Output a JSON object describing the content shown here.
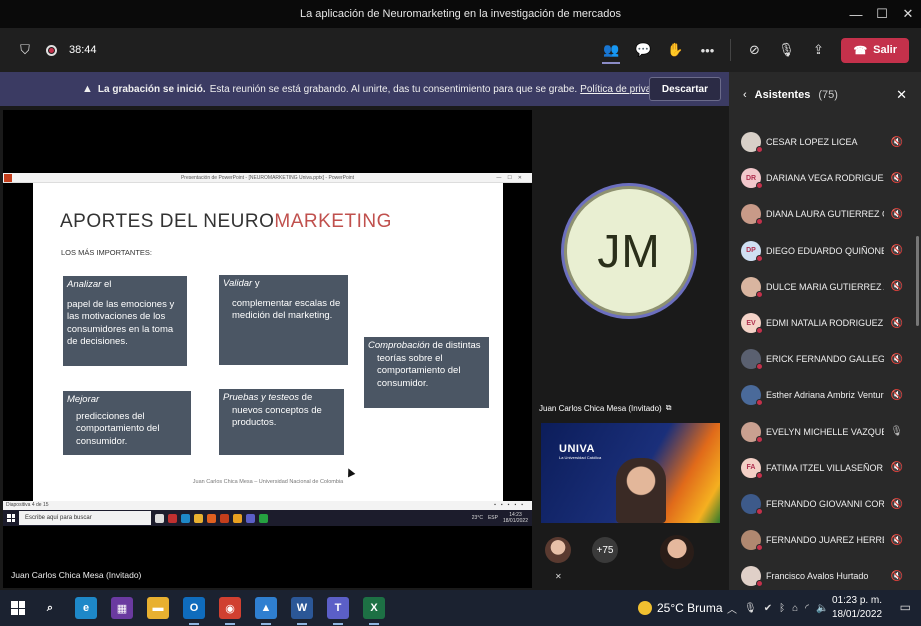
{
  "window": {
    "title": "La aplicación de Neuromarketing en la investigación de mercados"
  },
  "meeting": {
    "timer": "38:44",
    "leave_label": "Salir",
    "icons": [
      "shield-icon",
      "record-icon",
      "people-icon",
      "chat-icon",
      "reactions-icon",
      "more-icon",
      "camera-off-icon",
      "mic-off-icon",
      "share-icon"
    ]
  },
  "banner": {
    "bold": "La grabación se inició.",
    "text": "Esta reunión se está grabando. Al unirte, das tu consentimiento para que se grabe.",
    "link": "Política de privacidad",
    "dismiss": "Descartar"
  },
  "share": {
    "presenter_label": "Juan Carlos Chica Mesa (Invitado)",
    "ppt_title": "Presentación de PowerPoint - [NEUROMARKETING Univa.pptx] - PowerPoint",
    "slide_status": "Diapositiva 4 de 15",
    "slide": {
      "title_a": "APORTES DEL NEURO",
      "title_b": "MARKETING",
      "subtitle": "LOS MÁS IMPORTANTES:",
      "boxes": [
        {
          "head": "Analizar",
          "head_rest": " el",
          "body": "papel de las emociones y las motivaciones de los consumidores en la toma de decisiones."
        },
        {
          "head": "Validar",
          "head_rest": " y",
          "body": "complementar escalas de medición del marketing."
        },
        {
          "head": "Comprobación",
          "head_rest": " de distintas",
          "body": "teorías sobre el comportamiento del consumidor."
        },
        {
          "head": "Mejorar",
          "head_rest": "",
          "body": "predicciones del comportamiento del consumidor."
        },
        {
          "head": "Pruebas y testeos",
          "head_rest": " de",
          "body": "nuevos conceptos de productos."
        }
      ],
      "footer": "Juan Carlos Chica Mesa – Universidad Nacional de Colombia"
    },
    "inner_taskbar": {
      "search": "Escribe aquí para buscar",
      "weather": "23°C",
      "lang": "ESP",
      "time": "14:23",
      "date": "18/01/2022"
    }
  },
  "stage": {
    "avatar_initials": "JM",
    "camera_label": "Juan Carlos Chica Mesa (Invitado)",
    "camera_logo": "UNIVA",
    "camera_logo_sub": "La Universidad Católica",
    "overflow_count": "+75"
  },
  "attendees": {
    "title": "Asistentes",
    "count": "(75)",
    "list": [
      {
        "name": "CESAR LOPEZ LICEA",
        "initials": "",
        "color": "#d8d0c8",
        "mic": "mic-off-icon"
      },
      {
        "name": "DARIANA VEGA RODRIGUEZ",
        "initials": "DR",
        "color": "#f1c7cb",
        "mic": "mic-off-icon"
      },
      {
        "name": "DIANA LAURA GUTIERREZ G...",
        "initials": "",
        "color": "#c89a88",
        "mic": "mic-off-icon"
      },
      {
        "name": "DIEGO EDUARDO QUIÑONEZ...",
        "initials": "DP",
        "color": "#cfe0f3",
        "mic": "mic-off-icon"
      },
      {
        "name": "DULCE MARIA GUTIERREZ AN...",
        "initials": "",
        "color": "#d9b5a0",
        "mic": "mic-off-icon"
      },
      {
        "name": "EDMI NATALIA RODRIGUEZ V...",
        "initials": "EV",
        "color": "#f4d3c8",
        "mic": "mic-off-icon"
      },
      {
        "name": "ERICK FERNANDO GALLEGOS...",
        "initials": "",
        "color": "#5a6070",
        "mic": "mic-off-icon"
      },
      {
        "name": "Esther Adriana Ambriz Ventura",
        "initials": "",
        "color": "#4a6a9a",
        "mic": "mic-off-icon"
      },
      {
        "name": "EVELYN MICHELLE VAZQUEZ ...",
        "initials": "",
        "color": "#c9a090",
        "mic": "mic-icon"
      },
      {
        "name": "FATIMA ITZEL VILLASEÑOR AL...",
        "initials": "FA",
        "color": "#f3d0c6",
        "mic": "mic-off-icon"
      },
      {
        "name": "FERNANDO GIOVANNI CORR...",
        "initials": "",
        "color": "#3d5a8a",
        "mic": "mic-off-icon"
      },
      {
        "name": "FERNANDO JUAREZ HERRERA",
        "initials": "",
        "color": "#b08870",
        "mic": "mic-off-icon"
      },
      {
        "name": "Francisco Avalos Hurtado",
        "initials": "",
        "color": "#e0d0c8",
        "mic": "mic-off-icon"
      }
    ]
  },
  "taskbar": {
    "weather": "25°C  Bruma",
    "time": "01:23 p. m.",
    "date": "18/01/2022",
    "apps": [
      {
        "label": "⌕",
        "color": "transparent",
        "running": false
      },
      {
        "label": "e",
        "color": "#1e88c8",
        "running": false
      },
      {
        "label": "▦",
        "color": "#6a3aa0",
        "running": false
      },
      {
        "label": "▬",
        "color": "#e8b030",
        "running": false
      },
      {
        "label": "O",
        "color": "#0f6cbd",
        "running": true
      },
      {
        "label": "◉",
        "color": "#d04030",
        "running": true
      },
      {
        "label": "▲",
        "color": "#2f7fd0",
        "running": true
      },
      {
        "label": "W",
        "color": "#2b5797",
        "running": true
      },
      {
        "label": "T",
        "color": "#5b5fc7",
        "running": true
      },
      {
        "label": "X",
        "color": "#1d7044",
        "running": true
      }
    ]
  }
}
